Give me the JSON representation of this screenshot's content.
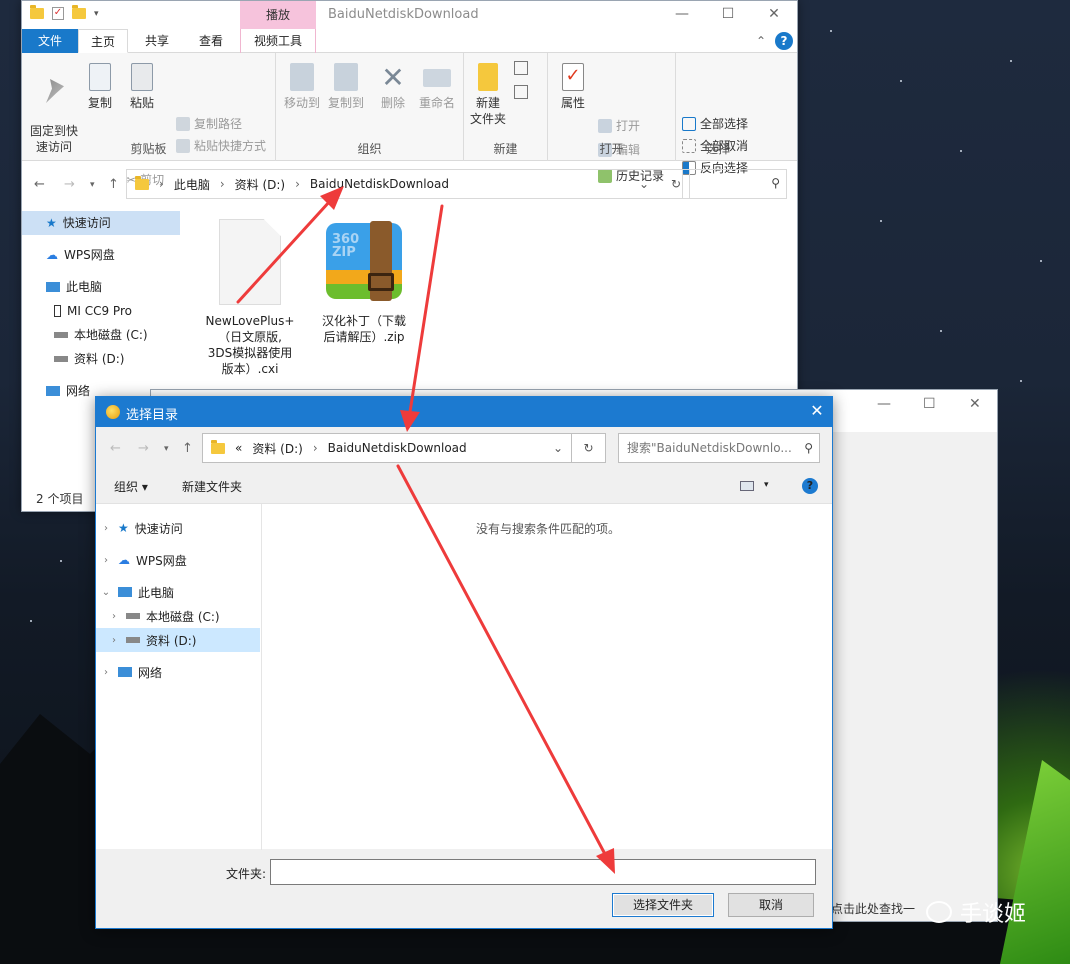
{
  "explorer": {
    "title": "BaiduNetdiskDownload",
    "context_tab": "播放",
    "tabs": [
      "文件",
      "主页",
      "共享",
      "查看",
      "视频工具"
    ],
    "ribbon": {
      "clipboard": {
        "pin": "固定到快\n速访问",
        "copy": "复制",
        "paste": "粘贴",
        "copy_path": "复制路径",
        "paste_shortcut": "粘贴快捷方式",
        "cut": "剪切",
        "label": "剪贴板"
      },
      "organize": {
        "move_to": "移动到",
        "copy_to": "复制到",
        "delete": "删除",
        "rename": "重命名",
        "label": "组织"
      },
      "new": {
        "new_folder": "新建\n文件夹",
        "label": "新建"
      },
      "open": {
        "properties": "属性",
        "open": "打开",
        "edit": "编辑",
        "history": "历史记录",
        "label": "打开"
      },
      "select": {
        "select_all": "全部选择",
        "select_none": "全部取消",
        "invert": "反向选择",
        "label": "选择"
      }
    },
    "address": {
      "crumbs": [
        "此电脑",
        "资料 (D:)",
        "BaiduNetdiskDownload"
      ]
    },
    "nav": [
      "快速访问",
      "WPS网盘",
      "此电脑",
      "MI CC9 Pro",
      "本地磁盘 (C:)",
      "资料 (D:)",
      "网络"
    ],
    "files": [
      {
        "name": "NewLovePlus+\n（日文原版,\n3DS模拟器使用\n版本）.cxi"
      },
      {
        "name": "汉化补丁（下载\n后请解压）.zip"
      }
    ],
    "zip_icon_text": "360\nZIP",
    "status": "2 个项目"
  },
  "dialog": {
    "title": "选择目录",
    "address_prefix": "«",
    "crumbs": [
      "资料 (D:)",
      "BaiduNetdiskDownload"
    ],
    "search_placeholder": "搜索\"BaiduNetdiskDownlo...",
    "organize": "组织 ▾",
    "new_folder": "新建文件夹",
    "tree": [
      "快速访问",
      "WPS网盘",
      "此电脑",
      "本地磁盘 (C:)",
      "资料 (D:)",
      "网络"
    ],
    "empty_message": "没有与搜索条件匹配的项。",
    "folder_label": "文件夹:",
    "folder_value": "",
    "ok": "选择文件夹",
    "cancel": "取消"
  },
  "background_window": {
    "partial_text": "点击此处查找一"
  },
  "watermark": "手谈姬",
  "colors": {
    "accent": "#1c7ad0",
    "arrow": "#ee3b3b",
    "ctx_tab": "#f6c3dc"
  }
}
